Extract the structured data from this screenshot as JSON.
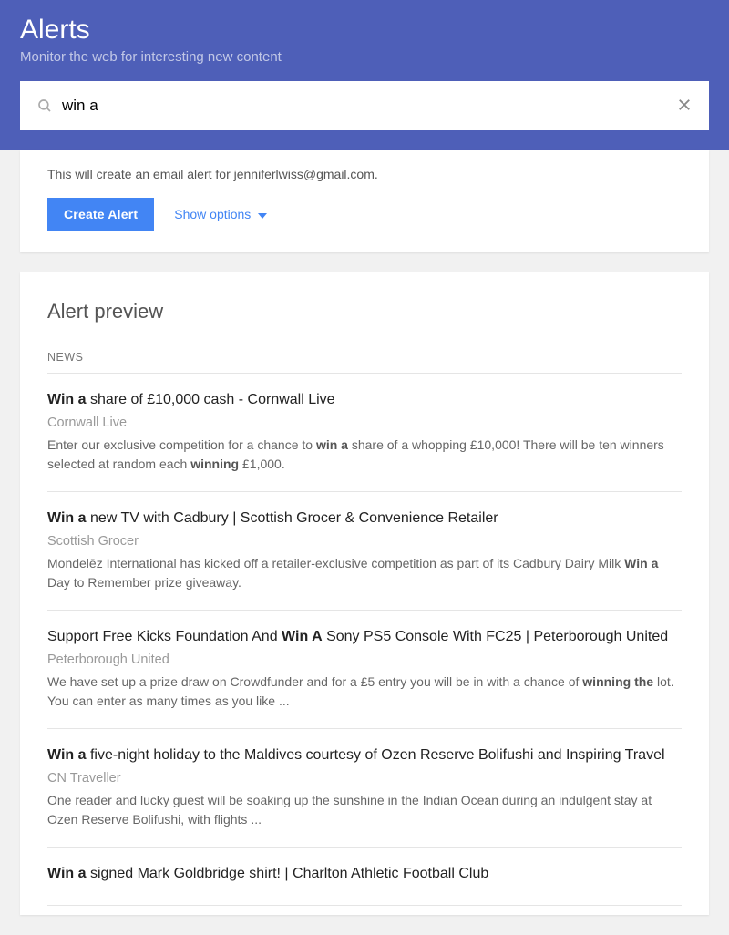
{
  "header": {
    "title": "Alerts",
    "subtitle": "Monitor the web for interesting new content"
  },
  "search": {
    "value": "win a"
  },
  "create": {
    "info": "This will create an email alert for jenniferlwiss@gmail.com.",
    "button": "Create Alert",
    "options": "Show options"
  },
  "preview": {
    "title": "Alert preview",
    "section": "NEWS",
    "results": [
      {
        "title_html": "<b>Win a</b> share of £10,000 cash - Cornwall Live",
        "source": "Cornwall Live",
        "snippet_html": "Enter our exclusive competition for a chance to <b>win a</b> share of a whopping £10,000! There will be ten winners selected at random each <b>winning</b> £1,000."
      },
      {
        "title_html": "<b>Win a</b> new TV with Cadbury | Scottish Grocer & Convenience Retailer",
        "source": "Scottish Grocer",
        "snippet_html": "Mondelēz International has kicked off a retailer-exclusive competition as part of its Cadbury Dairy Milk <b>Win a</b> Day to Remember prize giveaway."
      },
      {
        "title_html": "Support Free Kicks Foundation And <b>Win A</b> Sony PS5 Console With FC25 | Peterborough United",
        "source": "Peterborough United",
        "snippet_html": "We have set up a prize draw on Crowdfunder and for a £5 entry you will be in with a chance of <b>winning the</b> lot. You can enter as many times as you like ..."
      },
      {
        "title_html": "<b>Win a</b> five-night holiday to the Maldives courtesy of Ozen Reserve Bolifushi and Inspiring Travel",
        "source": "CN Traveller",
        "snippet_html": "One reader and lucky guest will be soaking up the sunshine in the Indian Ocean during an indulgent stay at Ozen Reserve Bolifushi, with flights ..."
      },
      {
        "title_html": "<b>Win a</b> signed Mark Goldbridge shirt! | Charlton Athletic Football Club",
        "source": "",
        "snippet_html": ""
      }
    ]
  }
}
